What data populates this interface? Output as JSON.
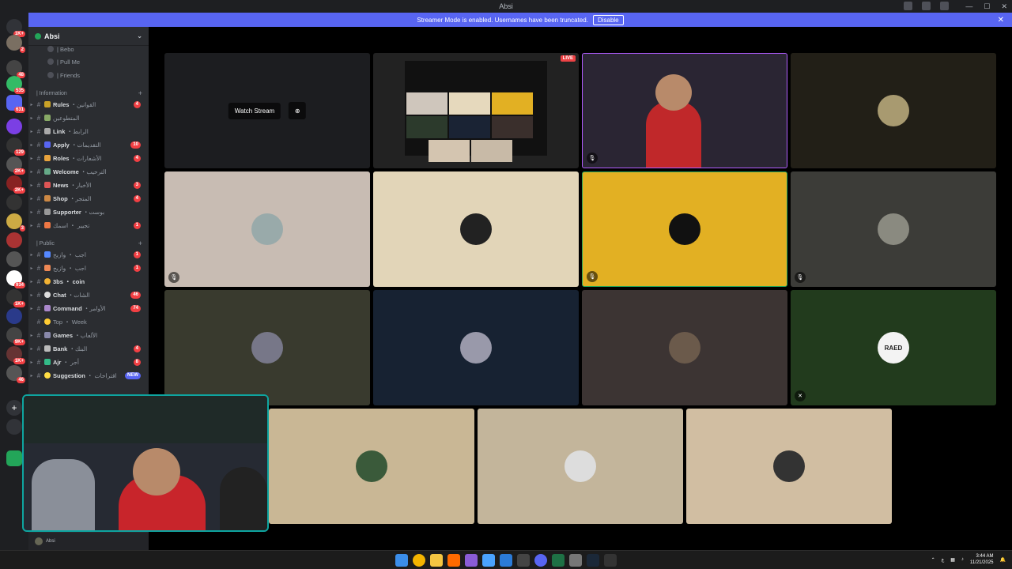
{
  "window": {
    "title": "Absi"
  },
  "banner": {
    "text": "Streamer Mode is enabled. Usernames have been truncated.",
    "disable_label": "Disable"
  },
  "server": {
    "name": "Absi"
  },
  "voice_channels": [
    {
      "name": "| Bebo"
    },
    {
      "name": "| Pull Me"
    },
    {
      "name": "| Friends"
    }
  ],
  "categories": {
    "information": "| Information",
    "public": "| Public"
  },
  "info_channels": [
    {
      "name": "Rules",
      "sub": "・القوانين",
      "count": "4"
    },
    {
      "name": "",
      "sub": "المتطوعين",
      "count": ""
    },
    {
      "name": "Link",
      "sub": "・الرابط",
      "count": ""
    },
    {
      "name": "Apply",
      "sub": "・التقديمات",
      "count": "10"
    },
    {
      "name": "Roles",
      "sub": "・الأشعارات",
      "count": "4"
    },
    {
      "name": "Welcome",
      "sub": "・الترحيب",
      "count": ""
    },
    {
      "name": "News",
      "sub": "・الأخبار",
      "count": "3"
    },
    {
      "name": "Shop",
      "sub": "・المتجر",
      "count": "4"
    },
    {
      "name": "Supporter",
      "sub": "・بوست",
      "count": ""
    },
    {
      "name": "",
      "sub": "تجيير ・ اسمك",
      "count": "1"
    }
  ],
  "public_channels": [
    {
      "name": "",
      "sub": "اجب ・ وازيح",
      "count": "1"
    },
    {
      "name": "",
      "sub": "اجب ・ وازيح",
      "count": "1"
    },
    {
      "name": "3bs",
      "sub": "・ coin",
      "count": ""
    },
    {
      "name": "Chat",
      "sub": "・الشات",
      "count": "46"
    },
    {
      "name": "Command",
      "sub": "・الأوامر",
      "count": "74"
    },
    {
      "name": "Top",
      "sub": "・ Week",
      "count": ""
    },
    {
      "name": "Games",
      "sub": "・الألعاب",
      "count": ""
    },
    {
      "name": "Bank",
      "sub": "・البنك",
      "count": "4"
    },
    {
      "name": "Ajr",
      "sub": "・ أجر",
      "count": "8"
    },
    {
      "name": "Suggestion",
      "sub": "・ اقتراحات",
      "count": "NEW"
    }
  ],
  "server_badges": [
    "1K+",
    "2",
    "48",
    "535",
    "631",
    "129",
    "2K+",
    "2K+",
    "3",
    "934",
    "1K+",
    "9K+",
    "1K+",
    "46"
  ],
  "stage": {
    "watch_label": "Watch Stream",
    "live_label": "LIVE",
    "avatar_text_raed": "RAED"
  },
  "user": {
    "name": "Absi"
  },
  "clock": {
    "time": "3:44 AM",
    "date": "11/21/2025"
  },
  "tray": {
    "lang": "ع"
  },
  "colors": {
    "blurple": "#5865f2",
    "danger": "#f23f43",
    "online": "#23a559",
    "gold_tile": "#e2b023"
  }
}
